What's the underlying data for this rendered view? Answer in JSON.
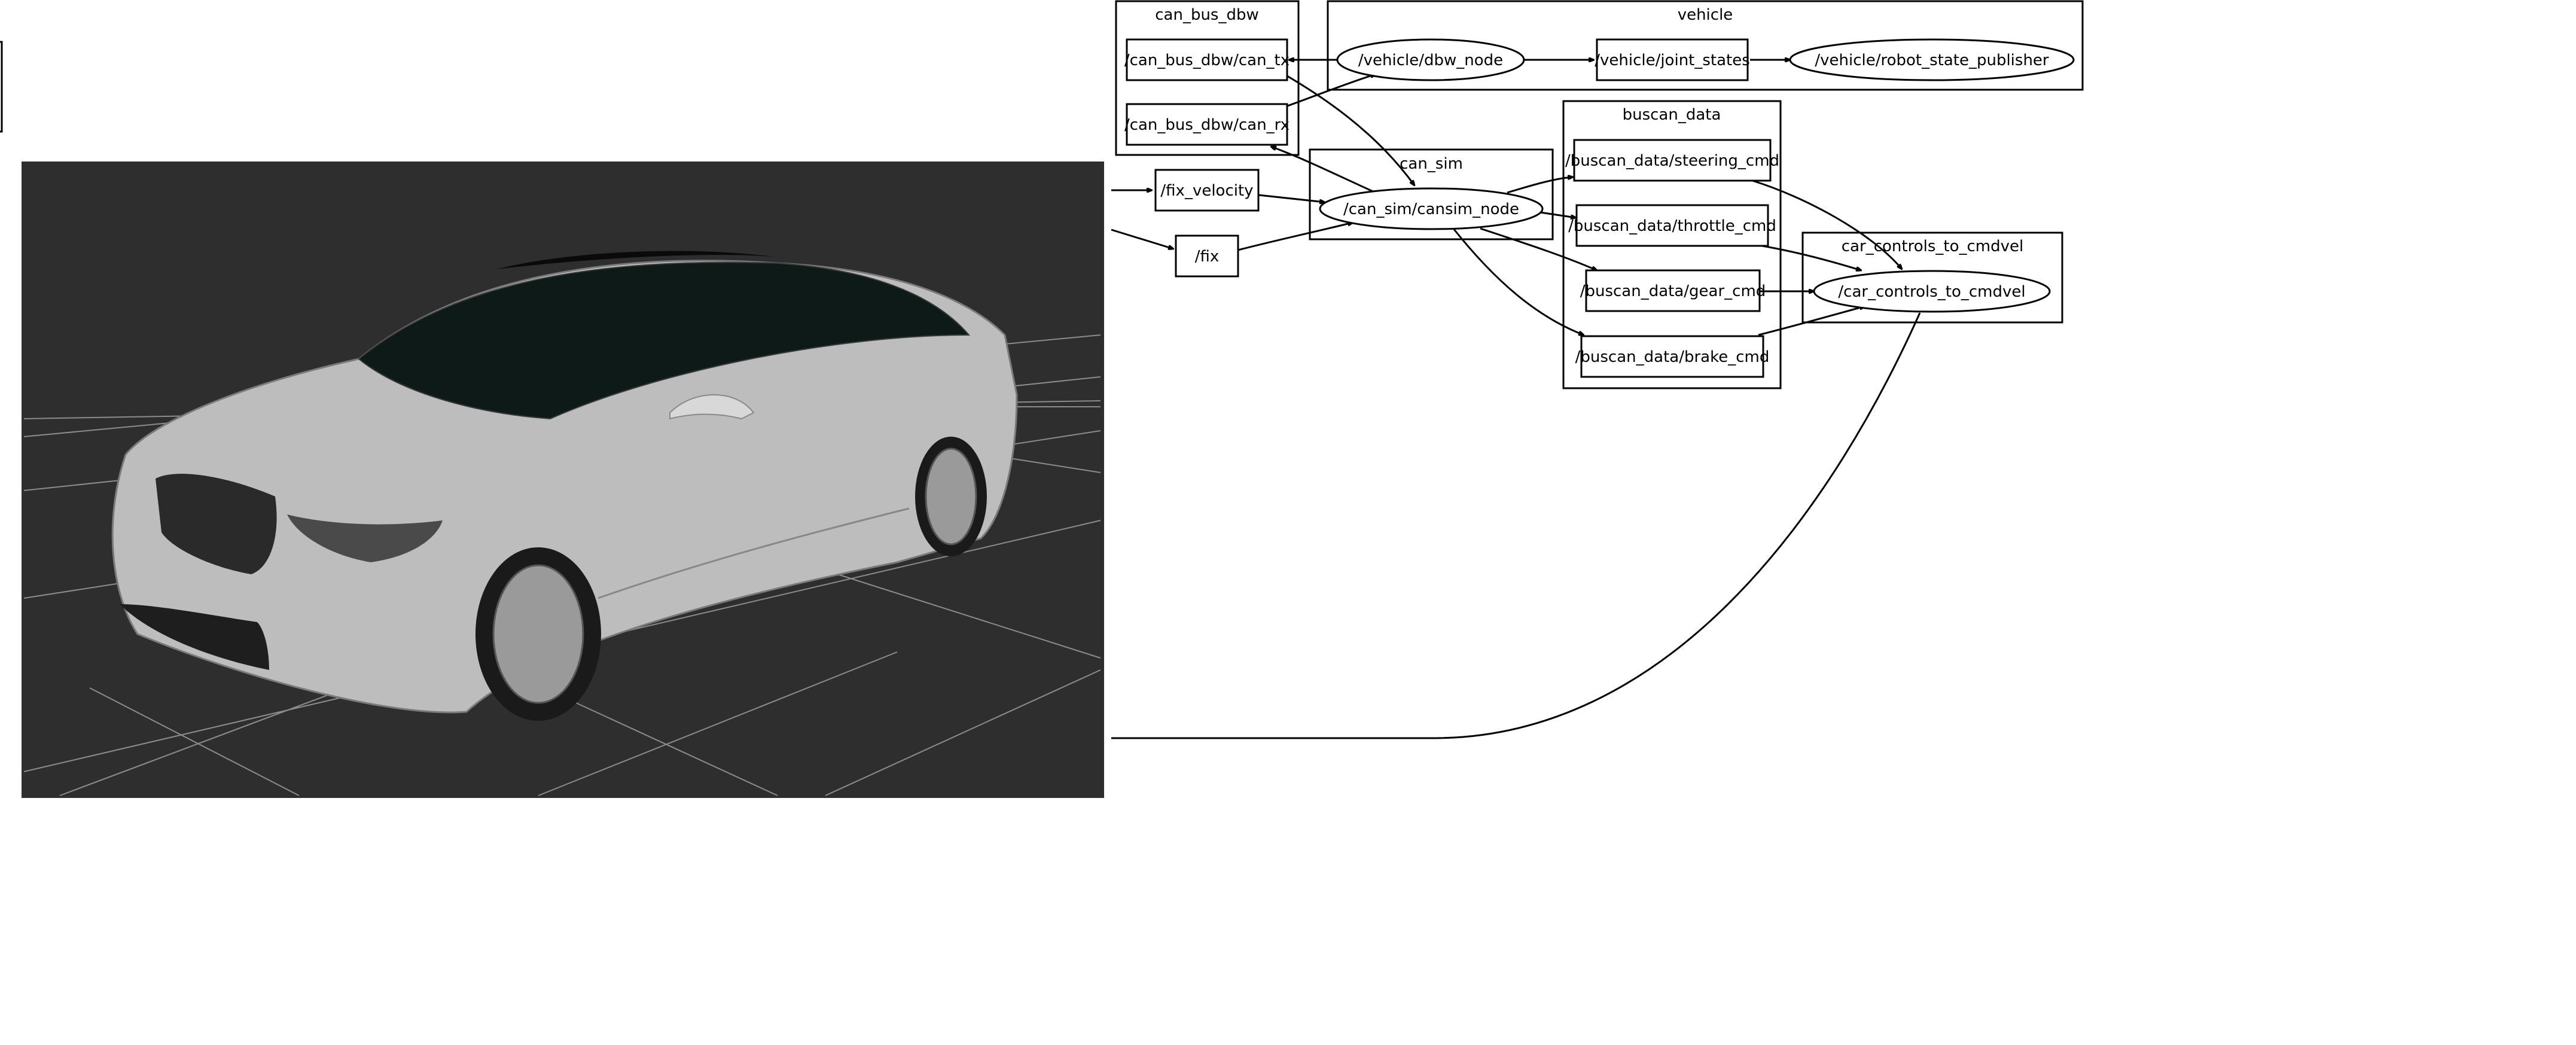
{
  "clusters": {
    "can_bus_dbw": "can_bus_dbw",
    "vehicle": "vehicle",
    "buscan_data": "buscan_data",
    "can_sim": "can_sim",
    "car_controls_to_cmdvel": "car_controls_to_cmdvel"
  },
  "nodes": {
    "can_tx": "/can_bus_dbw/can_tx",
    "can_rx": "/can_bus_dbw/can_rx",
    "dbw_node": "/vehicle/dbw_node",
    "joint_states": "/vehicle/joint_states",
    "robot_state_publisher": "/vehicle/robot_state_publisher",
    "fix_velocity": "/fix_velocity",
    "fix": "/fix",
    "cansim_node": "/can_sim/cansim_node",
    "steering_cmd": "/buscan_data/steering_cmd",
    "throttle_cmd": "/buscan_data/throttle_cmd",
    "gear_cmd": "/buscan_data/gear_cmd",
    "brake_cmd": "/buscan_data/brake_cmd",
    "car_controls": "/car_controls_to_cmdvel"
  },
  "colors": {
    "viewport_bg": "#2e2e2e",
    "grid": "#8c8c8c",
    "car_body": "#bdbdbd"
  },
  "viewport": {
    "content": "3D render of a grey sedan on a grid floor"
  }
}
